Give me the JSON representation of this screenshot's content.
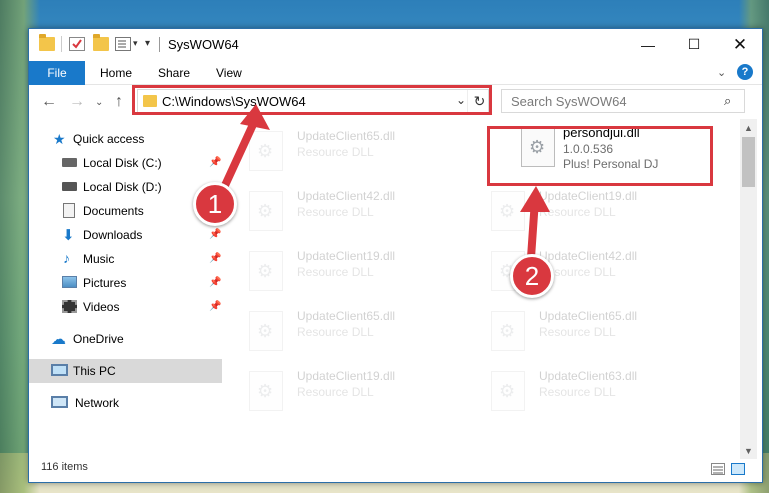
{
  "window": {
    "title": "SysWOW64"
  },
  "ribbon": {
    "tabs": [
      "File",
      "Home",
      "Share",
      "View"
    ],
    "help": "?"
  },
  "nav": {
    "address": "C:\\Windows\\SysWOW64",
    "search_placeholder": "Search SysWOW64"
  },
  "sidebar": {
    "items": [
      {
        "label": "Quick access",
        "icon": "star-icon",
        "pinned": false
      },
      {
        "label": "Local Disk (C:)",
        "icon": "drive-icon",
        "pinned": true
      },
      {
        "label": "Local Disk (D:)",
        "icon": "drive-icon",
        "pinned": true
      },
      {
        "label": "Documents",
        "icon": "documents-icon",
        "pinned": false
      },
      {
        "label": "Downloads",
        "icon": "download-icon",
        "pinned": true
      },
      {
        "label": "Music",
        "icon": "music-icon",
        "pinned": true
      },
      {
        "label": "Pictures",
        "icon": "pictures-icon",
        "pinned": true
      },
      {
        "label": "Videos",
        "icon": "videos-icon",
        "pinned": true
      },
      {
        "label": "OneDrive",
        "icon": "cloud-icon",
        "pinned": false
      },
      {
        "label": "This PC",
        "icon": "computer-icon",
        "pinned": false
      },
      {
        "label": "Network",
        "icon": "network-icon",
        "pinned": false
      }
    ]
  },
  "files": {
    "highlighted": {
      "name": "persondjui.dll",
      "version": "1.0.0.536",
      "description": "Plus! Personal DJ"
    },
    "left_column": [
      {
        "name": "UpdateClient65.dll",
        "type": "Resource DLL"
      },
      {
        "name": "UpdateClient42.dll",
        "type": "Resource DLL"
      },
      {
        "name": "UpdateClient19.dll",
        "type": "Resource DLL"
      },
      {
        "name": "UpdateClient65.dll",
        "type": "Resource DLL"
      },
      {
        "name": "UpdateClient19.dll",
        "type": "Resource DLL"
      }
    ],
    "right_column": [
      {
        "name": "UpdateClient19.dll",
        "type": "Resource DLL"
      },
      {
        "name": "UpdateClient42.dll",
        "type": "Resource DLL"
      },
      {
        "name": "UpdateClient65.dll",
        "type": "Resource DLL"
      },
      {
        "name": "UpdateClient63.dll",
        "type": "Resource DLL"
      }
    ]
  },
  "status": {
    "item_count": "116 items"
  },
  "callouts": [
    "1",
    "2"
  ],
  "colors": {
    "accent": "#1979ca",
    "highlight": "#d9383f"
  }
}
